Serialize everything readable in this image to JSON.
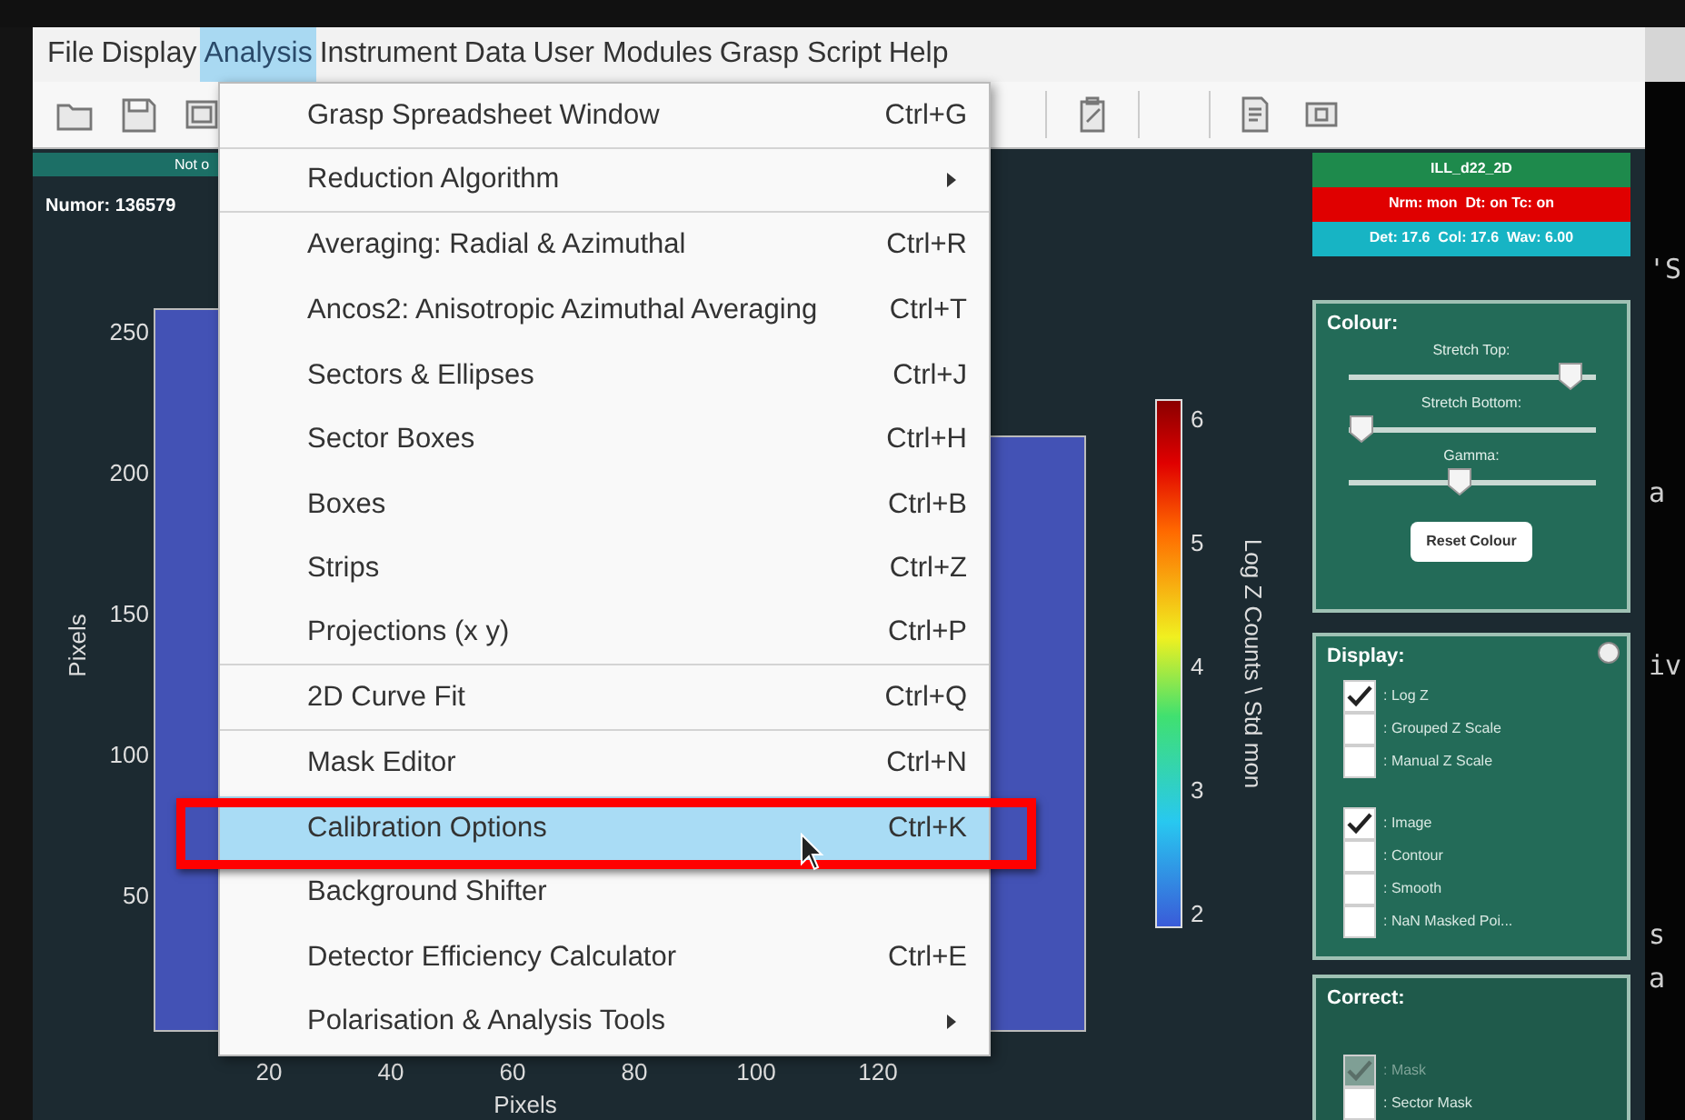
{
  "menubar": [
    {
      "label": "File",
      "selected": false
    },
    {
      "label": "Display",
      "selected": false
    },
    {
      "label": "Analysis",
      "selected": true
    },
    {
      "label": "Instrument",
      "selected": false
    },
    {
      "label": "Data",
      "selected": false
    },
    {
      "label": "User Modules",
      "selected": false
    },
    {
      "label": "Grasp Script",
      "selected": false
    },
    {
      "label": "Help",
      "selected": false
    }
  ],
  "info_strip": "Not o",
  "numor": "Numor: 136579",
  "status_badges": [
    {
      "text": "ILL_d22_2D",
      "color": "#1e8a4c"
    },
    {
      "text": "Nrm: mon  Dt: on Tc: on",
      "color": "#e00000"
    },
    {
      "text": "Det: 17.6  Col: 17.6  Wav: 6.00",
      "color": "#17b4c4"
    }
  ],
  "plot": {
    "ylabel": "Pixels",
    "yticks": [
      "250",
      "200",
      "150",
      "100",
      "50"
    ],
    "xlabel": "Pixels",
    "xticks": [
      "20",
      "40",
      "60",
      "80",
      "100",
      "120"
    ]
  },
  "colorbar": {
    "ticks": [
      "6",
      "5",
      "4",
      "3",
      "2"
    ],
    "label": "Log Z   Counts \\ Std mon"
  },
  "colour_panel": {
    "title": "Colour:",
    "sliders": [
      {
        "label": "Stretch Top:",
        "level": 0.95
      },
      {
        "label": "Stretch Bottom:",
        "level": 0.0
      },
      {
        "label": "Gamma:",
        "level": 0.45
      }
    ],
    "button": "Reset Colour"
  },
  "display_panel": {
    "title": "Display:",
    "groups": [
      [
        {
          "label": ": Log Z",
          "checked": true
        },
        {
          "label": ": Grouped Z Scale",
          "checked": false
        },
        {
          "label": ": Manual Z Scale",
          "checked": false
        }
      ],
      [
        {
          "label": ": Image",
          "checked": true
        },
        {
          "label": ": Contour",
          "checked": false
        },
        {
          "label": ": Smooth",
          "checked": false
        },
        {
          "label": ": NaN Masked Poi...",
          "checked": false
        }
      ]
    ]
  },
  "correct_panel": {
    "title": "Correct:",
    "checkboxes": [
      {
        "label": ": Mask",
        "checked": true,
        "disabled": true
      },
      {
        "label": ": Sector Mask",
        "checked": false,
        "disabled": false
      }
    ]
  },
  "analysis_menu": [
    {
      "label": "Grasp Spreadsheet Window",
      "shortcut": "Ctrl+G",
      "submenu": false,
      "selected": false,
      "separator_after": true
    },
    {
      "label": "Reduction Algorithm",
      "submenu": true,
      "selected": false,
      "separator_after": true
    },
    {
      "label": "Averaging: Radial & Azimuthal",
      "shortcut": "Ctrl+R",
      "submenu": false,
      "selected": false,
      "separator_after": false
    },
    {
      "label": "Ancos2: Anisotropic Azimuthal Averaging",
      "shortcut": "Ctrl+T",
      "submenu": false,
      "selected": false,
      "separator_after": false
    },
    {
      "label": "Sectors & Ellipses",
      "shortcut": "Ctrl+J",
      "submenu": false,
      "selected": false,
      "separator_after": false
    },
    {
      "label": "Sector Boxes",
      "shortcut": "Ctrl+H",
      "submenu": false,
      "selected": false,
      "separator_after": false
    },
    {
      "label": "Boxes",
      "shortcut": "Ctrl+B",
      "submenu": false,
      "selected": false,
      "separator_after": false
    },
    {
      "label": "Strips",
      "shortcut": "Ctrl+Z",
      "submenu": false,
      "selected": false,
      "separator_after": false
    },
    {
      "label": "Projections (x y)",
      "shortcut": "Ctrl+P",
      "submenu": false,
      "selected": false,
      "separator_after": true
    },
    {
      "label": "2D Curve Fit",
      "shortcut": "Ctrl+Q",
      "submenu": false,
      "selected": false,
      "separator_after": true
    },
    {
      "label": "Mask Editor",
      "shortcut": "Ctrl+N",
      "submenu": false,
      "selected": false,
      "separator_after": false
    },
    {
      "label": "Calibration Options",
      "shortcut": "Ctrl+K",
      "submenu": false,
      "selected": true,
      "separator_after": false
    },
    {
      "label": "Background Shifter",
      "submenu": false,
      "selected": false,
      "separator_after": false
    },
    {
      "label": "Detector Efficiency Calculator",
      "shortcut": "Ctrl+E",
      "submenu": false,
      "selected": false,
      "separator_after": false
    },
    {
      "label": "Polarisation & Analysis Tools",
      "submenu": true,
      "selected": false,
      "separator_after": false
    }
  ],
  "terminal_fragments": [
    "'S",
    "a",
    "iv",
    "s",
    "a"
  ]
}
